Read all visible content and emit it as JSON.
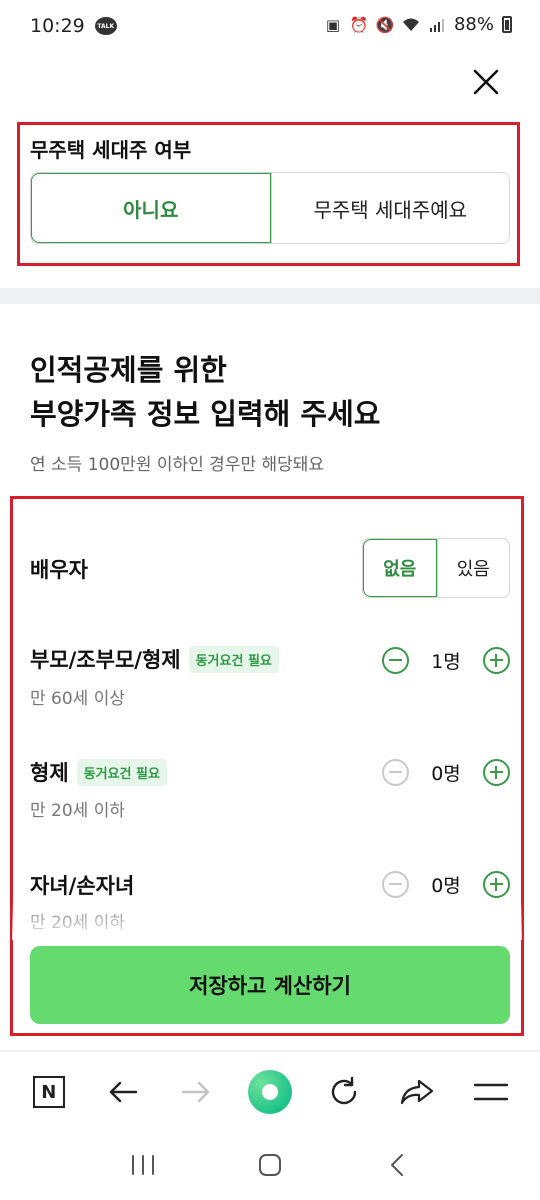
{
  "status_bar": {
    "time": "10:29",
    "talk_badge": "TALK",
    "battery": "88%"
  },
  "homeless_householder": {
    "label": "무주택 세대주 여부",
    "options": [
      "아니요",
      "무주택 세대주예요"
    ],
    "selected": "아니요"
  },
  "dependents": {
    "heading_line1": "인적공제를 위한",
    "heading_line2": "부양가족 정보 입력해 주세요",
    "subtext": "연 소득 100만원 이하인 경우만 해당돼요",
    "spouse": {
      "label": "배우자",
      "options": [
        "없음",
        "있음"
      ],
      "selected": "없음"
    },
    "rows": [
      {
        "label": "부모/조부모/형제",
        "chip": "동거요건 필요",
        "sub": "만 60세 이상",
        "count": "1명",
        "minus_enabled": true
      },
      {
        "label": "형제",
        "chip": "동거요건 필요",
        "sub": "만 20세 이하",
        "count": "0명",
        "minus_enabled": false
      },
      {
        "label": "자녀/손자녀",
        "chip": "",
        "sub": "만 20세 이하",
        "count": "0명",
        "minus_enabled": false
      }
    ]
  },
  "save_button": "저장하고 계산하기",
  "browser_bar": {
    "n_label": "N",
    "icons": [
      "naver-icon",
      "back-arrow-icon",
      "forward-arrow-icon",
      "green-ball-icon",
      "refresh-icon",
      "share-icon",
      "menu-icon"
    ]
  },
  "colors": {
    "accent_green": "#3a9a4a",
    "button_green": "#65da6e",
    "highlight_red": "#d81e2a"
  }
}
